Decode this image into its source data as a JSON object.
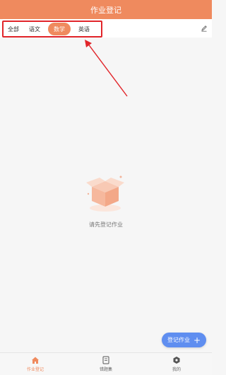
{
  "header": {
    "title": "作业登记"
  },
  "tabs": [
    {
      "label": "全部",
      "active": false
    },
    {
      "label": "语文",
      "active": false
    },
    {
      "label": "数学",
      "active": true
    },
    {
      "label": "英语",
      "active": false
    }
  ],
  "empty": {
    "message": "请先登记作业"
  },
  "fab": {
    "label": "登记作业",
    "plus": "+"
  },
  "bottom_nav": [
    {
      "label": "作业登记",
      "icon": "home-icon",
      "active": true
    },
    {
      "label": "错题集",
      "icon": "notebook-icon",
      "active": false
    },
    {
      "label": "我的",
      "icon": "hexagon-icon",
      "active": false
    }
  ],
  "colors": {
    "brand": "#ef8a5e",
    "fab": "#5f8ef0",
    "highlight_box": "#e1252a"
  }
}
